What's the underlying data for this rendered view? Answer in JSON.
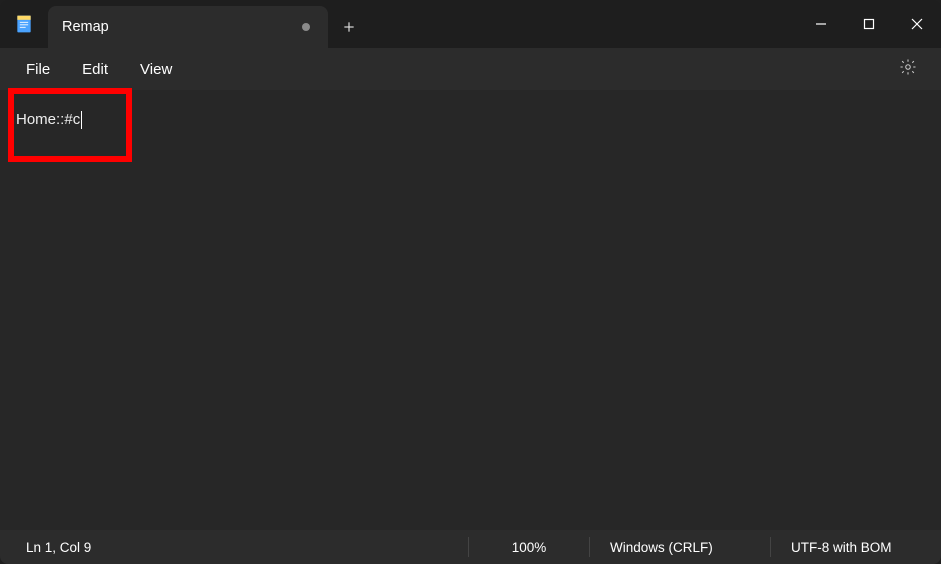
{
  "titlebar": {
    "tab_title": "Remap"
  },
  "menubar": {
    "file": "File",
    "edit": "Edit",
    "view": "View"
  },
  "editor": {
    "content": "Home::#c"
  },
  "statusbar": {
    "position": "Ln 1, Col 9",
    "zoom": "100%",
    "line_ending": "Windows (CRLF)",
    "encoding": "UTF-8 with BOM"
  },
  "icons": {
    "app": "notepad-icon",
    "new_tab": "plus-icon",
    "minimize": "minimize-icon",
    "maximize": "maximize-icon",
    "close": "close-icon",
    "settings": "gear-icon"
  }
}
